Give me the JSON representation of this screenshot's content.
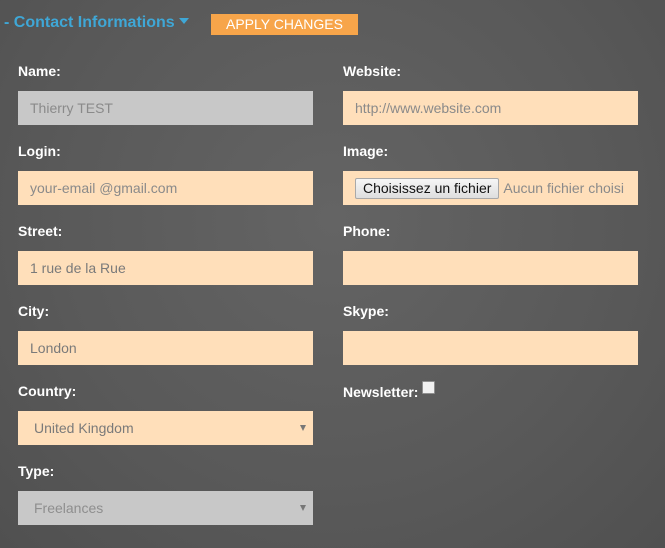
{
  "header": {
    "section_title": "- Contact Informations",
    "apply_label": "APPLY CHANGES"
  },
  "left": {
    "name": {
      "label": "Name:",
      "value": "Thierry TEST"
    },
    "login": {
      "label": "Login:",
      "placeholder": "your-email @gmail.com"
    },
    "street": {
      "label": "Street:",
      "value": "1 rue de la Rue"
    },
    "city": {
      "label": "City:",
      "value": "London"
    },
    "country": {
      "label": "Country:",
      "selected": "United Kingdom"
    },
    "type": {
      "label": "Type:",
      "selected": "Freelances"
    }
  },
  "right": {
    "website": {
      "label": "Website:",
      "placeholder": "http://www.website.com"
    },
    "image": {
      "label": "Image:",
      "button_label": "Choisissez un fichier",
      "status": "Aucun fichier choisi"
    },
    "phone": {
      "label": "Phone:",
      "value": ""
    },
    "skype": {
      "label": "Skype:",
      "value": ""
    },
    "newsletter": {
      "label": "Newsletter:",
      "checked": false
    }
  },
  "colors": {
    "accent_blue": "#3fa7d6",
    "button_orange": "#f7a54a",
    "input_bg": "#ffdfba",
    "disabled_bg": "#c8c8c8",
    "background": "#5a5a5a"
  },
  "icons": {
    "section_toggle": "caret-down-icon",
    "select_arrow": "select-arrow-icon"
  }
}
